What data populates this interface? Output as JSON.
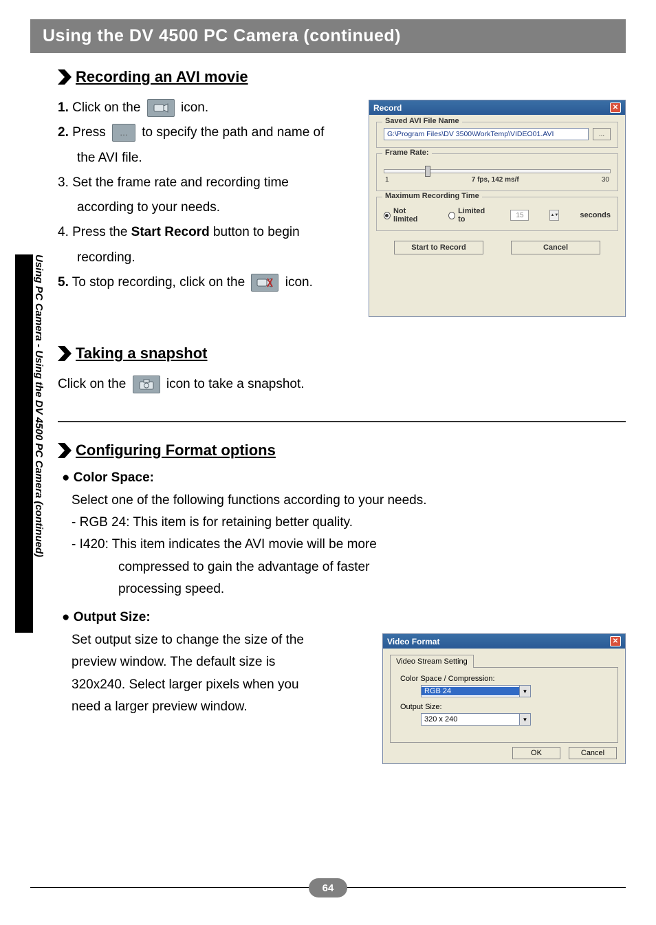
{
  "title_bar": "Using the DV 4500 PC Camera (continued)",
  "side_tab": "Using PC Camera - Using the DV 4500 PC Camera (continued)",
  "page_number": "64",
  "section_recording": {
    "heading": "Recording an AVI movie",
    "step1_a": "1.",
    "step1_b": "Click on the",
    "step1_c": "icon.",
    "step2_a": "2.",
    "step2_b": "Press",
    "step2_c": "to specify the path and name of",
    "step2_d": "the AVI file.",
    "step3": "3. Set the frame rate and recording time",
    "step3b": "according to your needs.",
    "step4_a": "4. Press the ",
    "step4_b": "Start Record",
    "step4_c": " button to begin",
    "step4_d": "recording.",
    "step5_a": "5.",
    "step5_b": "To stop recording, click on the",
    "step5_c": "icon."
  },
  "record_dialog": {
    "title": "Record",
    "saved_label": "Saved AVI File Name",
    "path_value": "G:\\Program Files\\DV 3500\\WorkTemp\\VIDEO01.AVI",
    "browse": "...",
    "frame_rate_label": "Frame Rate:",
    "slider_min": "1",
    "slider_mid": "7 fps, 142 ms/f",
    "slider_max": "30",
    "max_rec_label": "Maximum Recording Time",
    "opt_not_limited": "Not limited",
    "opt_limited_to": "Limited to",
    "spin_value": "15",
    "seconds": "seconds",
    "btn_start": "Start to Record",
    "btn_cancel": "Cancel"
  },
  "section_snapshot": {
    "heading": "Taking a snapshot",
    "text_a": "Click on the",
    "text_b": "icon to take a snapshot."
  },
  "section_format": {
    "heading": "Configuring Format options",
    "color_space_head": "Color Space:",
    "cs_line1": "Select one of the following functions according to your needs.",
    "cs_line2": "- RGB 24: This item is for retaining better quality.",
    "cs_line3": "- I420: This item indicates the AVI movie will be more",
    "cs_line3b": "compressed to gain the advantage of faster",
    "cs_line3c": "processing speed.",
    "output_size_head": "Output Size:",
    "os_line1": "Set output size to change the size of the",
    "os_line2": "preview window. The default size is",
    "os_line3": "320x240. Select larger pixels when you",
    "os_line4": "need a larger preview window."
  },
  "vf_dialog": {
    "title": "Video Format",
    "tab": "Video Stream Setting",
    "cs_label": "Color Space / Compression:",
    "cs_value": "RGB 24",
    "os_label": "Output Size:",
    "os_value": "320 x 240",
    "btn_ok": "OK",
    "btn_cancel": "Cancel"
  }
}
